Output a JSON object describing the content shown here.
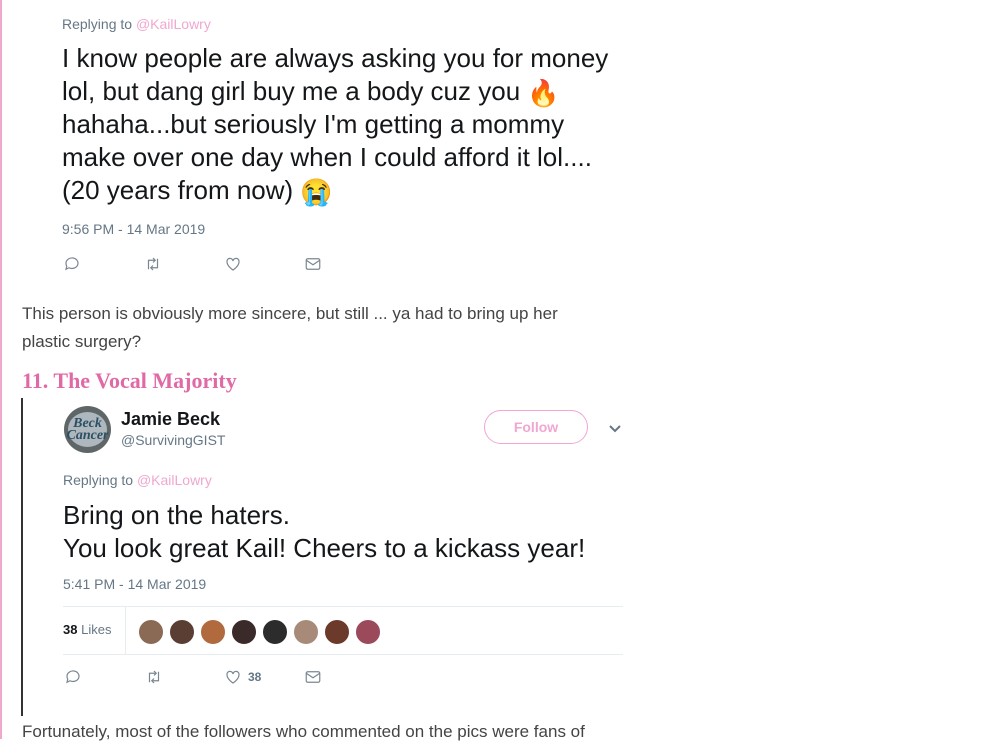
{
  "tweet1": {
    "replying_prefix": "Replying to",
    "replying_handle": "@KailLowry",
    "text_part1": "I know people are always asking you for money lol, but dang girl buy me a body cuz you",
    "emoji1": "🔥",
    "text_part2": "hahaha...but seriously I'm getting a mommy make over one day when I could afford it lol.... (20 years from now)",
    "emoji2": "😭",
    "timestamp": "9:56 PM - 14 Mar 2019"
  },
  "article": {
    "paragraph1_line1": "This person is obviously more sincere, but still ... ya had to bring up her",
    "paragraph1_line2": "plastic surgery?",
    "heading": "11. The Vocal Majority",
    "paragraph2": "Fortunately, most of the followers who commented on the pics were fans of"
  },
  "tweet2": {
    "avatar_text": "Beck Cancer",
    "name": "Jamie Beck",
    "handle": "@SurvivingGIST",
    "follow_label": "Follow",
    "replying_prefix": "Replying to",
    "replying_handle": "@KailLowry",
    "text_line1": "Bring on the haters.",
    "text_line2": "You look great Kail! Cheers to a kickass year!",
    "timestamp": "5:41 PM - 14 Mar 2019",
    "likes_count": "38",
    "likes_label": "Likes",
    "liker_colors": [
      "#8a6a55",
      "#5a3e33",
      "#b06a3e",
      "#3a2a2a",
      "#2c2c2c",
      "#a88a78",
      "#6b3a2a",
      "#9a4a5a"
    ],
    "like_action_count": "38"
  },
  "colors": {
    "accent_pink": "#e06aa6",
    "link_pink": "#f0a7d0",
    "muted_gray": "#657786"
  }
}
